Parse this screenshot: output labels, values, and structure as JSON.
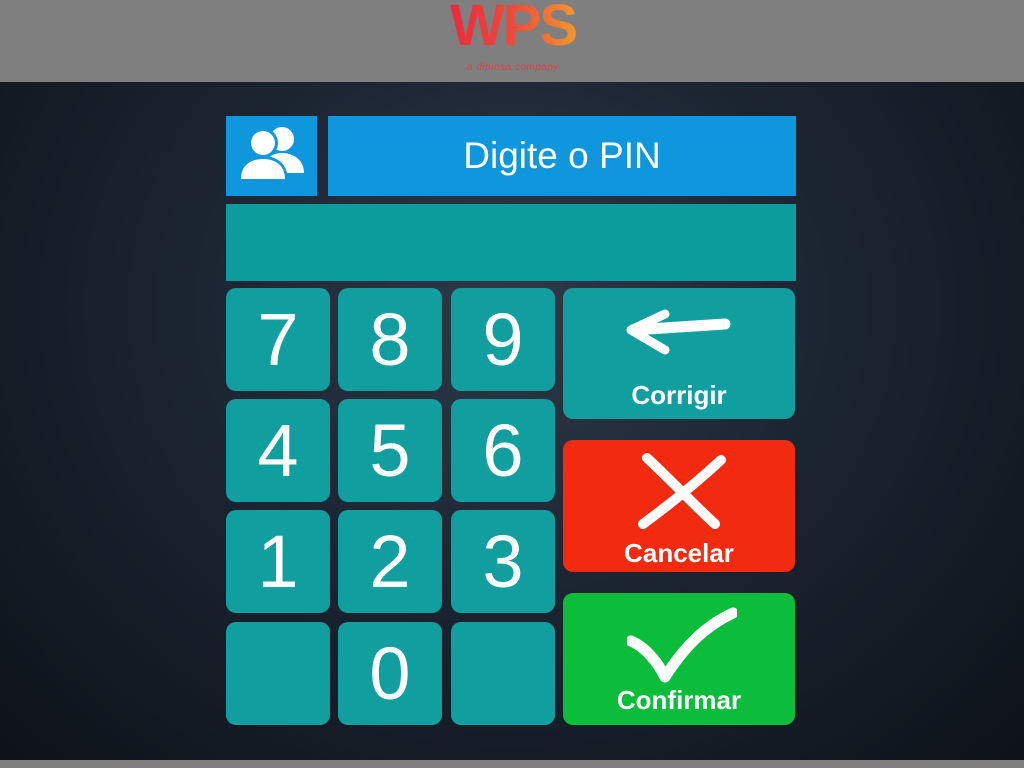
{
  "header": {
    "logo_text": "WPS",
    "logo_tagline": "a dipinsa company"
  },
  "pin_panel": {
    "title": "Digite o PIN",
    "pin_value": "",
    "user_icon": "users-icon"
  },
  "keypad": {
    "keys": [
      "7",
      "8",
      "9",
      "4",
      "5",
      "6",
      "1",
      "2",
      "3",
      "",
      "0",
      ""
    ]
  },
  "actions": {
    "correct": {
      "label": "Corrigir",
      "icon": "arrow-left-icon",
      "color": "#109e9e"
    },
    "cancel": {
      "label": "Cancelar",
      "icon": "close-icon",
      "color": "#f22a10"
    },
    "confirm": {
      "label": "Confirmar",
      "icon": "checkmark-icon",
      "color": "#0bbd3b"
    }
  },
  "colors": {
    "header_bar": "#7f7f7f",
    "title_blue": "#0f97dd",
    "teal": "#109e9e"
  }
}
